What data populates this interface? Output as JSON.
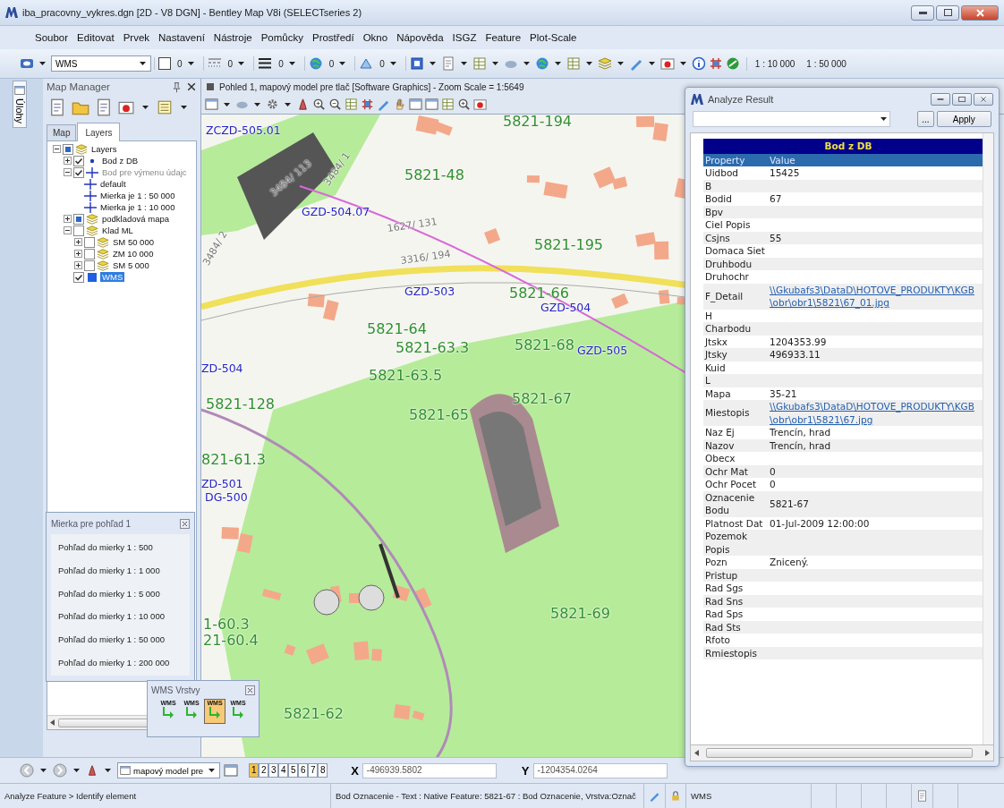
{
  "window": {
    "title": "iba_pracovny_vykres.dgn [2D - V8 DGN] - Bentley Map V8i (SELECTseries 2)"
  },
  "menu": [
    "Soubor",
    "Editovat",
    "Prvek",
    "Nastavení",
    "Nástroje",
    "Pomůcky",
    "Prostředí",
    "Okno",
    "Nápověda",
    "ISGZ",
    "Feature",
    "Plot-Scale"
  ],
  "toolbar": {
    "level": "WMS",
    "attribute_values": [
      "0",
      "0",
      "0",
      "0",
      "0"
    ],
    "scales": [
      "1 : 10 000",
      "1 : 50 000"
    ]
  },
  "side_tab": {
    "label": "Úlohy"
  },
  "map_manager": {
    "title": "Map Manager",
    "tabs": [
      {
        "label": "Map",
        "selected": false
      },
      {
        "label": "Layers",
        "selected": true
      }
    ],
    "tree": [
      {
        "label": "Layers",
        "kind": "group",
        "checked": true,
        "partial": true,
        "expanded": true,
        "selected": false,
        "disabled": false,
        "children": [
          {
            "label": "Bod z DB",
            "kind": "point",
            "checked": true,
            "partial": false,
            "expanded": false,
            "selected": false,
            "disabled": false
          },
          {
            "label": "Bod pre výmenu údajc",
            "kind": "cross",
            "checked": true,
            "partial": false,
            "expanded": true,
            "selected": false,
            "disabled": true,
            "children": [
              {
                "label": "default",
                "kind": "cross",
                "selected": false,
                "disabled": false
              },
              {
                "label": "Mierka je 1 : 50 000",
                "kind": "cross",
                "selected": false,
                "disabled": false
              },
              {
                "label": "Mierka je 1 : 10 000",
                "kind": "cross",
                "selected": false,
                "disabled": false
              }
            ]
          },
          {
            "label": "podkladová mapa",
            "kind": "group",
            "checked": true,
            "partial": true,
            "expanded": false,
            "selected": false,
            "disabled": false
          },
          {
            "label": "Klad ML",
            "kind": "group",
            "checked": false,
            "expanded": true,
            "selected": false,
            "disabled": false,
            "children": [
              {
                "label": "SM 50 000",
                "kind": "group",
                "checked": false,
                "expanded": false,
                "selected": false,
                "disabled": false
              },
              {
                "label": "ZM 10 000",
                "kind": "group",
                "checked": false,
                "expanded": false,
                "selected": false,
                "disabled": false
              },
              {
                "label": "SM 5 000",
                "kind": "group",
                "checked": false,
                "expanded": false,
                "selected": false,
                "disabled": false
              }
            ]
          },
          {
            "label": "WMS",
            "kind": "raster",
            "checked": true,
            "partial": false,
            "selected": true,
            "disabled": false
          }
        ]
      }
    ]
  },
  "map_view": {
    "title": "Pohled 1, mapový model pre tlač [Software Graphics] - Zoom Scale = 1:5649",
    "labels": [
      {
        "text": "5821-194",
        "kind": "point",
        "color": "#2f8f2f"
      },
      {
        "text": "ZCZD-505.01",
        "kind": "station",
        "color": "#2323c8"
      },
      {
        "text": "3484/ 113",
        "kind": "parcel",
        "color": "#777777"
      },
      {
        "text": "3484/ 1",
        "kind": "parcel",
        "color": "#777777"
      },
      {
        "text": "5821-48",
        "kind": "point",
        "color": "#2f8f2f"
      },
      {
        "text": "GZD-504.07",
        "kind": "station",
        "color": "#2323c8"
      },
      {
        "text": "1627/ 131",
        "kind": "parcel",
        "color": "#777777"
      },
      {
        "text": "3484/ 2",
        "kind": "parcel",
        "color": "#777777"
      },
      {
        "text": "3316/ 194",
        "kind": "parcel",
        "color": "#777777"
      },
      {
        "text": "5821-195",
        "kind": "point",
        "color": "#2f8f2f"
      },
      {
        "text": "GZD-503",
        "kind": "station",
        "color": "#2323c8"
      },
      {
        "text": "5821-66",
        "kind": "point",
        "color": "#2f8f2f"
      },
      {
        "text": "GZD-504",
        "kind": "station",
        "color": "#2323c8"
      },
      {
        "text": "5821-64",
        "kind": "point",
        "color": "#2f8f2f"
      },
      {
        "text": "5821-63.3",
        "kind": "point",
        "color": "#2f8f2f"
      },
      {
        "text": "5821-68",
        "kind": "point",
        "color": "#2f8f2f"
      },
      {
        "text": "GZD-505",
        "kind": "station",
        "color": "#2323c8"
      },
      {
        "text": "ZD-504",
        "kind": "station",
        "color": "#2323c8"
      },
      {
        "text": "5821-63.5",
        "kind": "point",
        "color": "#2f8f2f"
      },
      {
        "text": "5821-128",
        "kind": "point",
        "color": "#2f8f2f"
      },
      {
        "text": "5821-67",
        "kind": "point",
        "color": "#2f8f2f"
      },
      {
        "text": "5821-65",
        "kind": "point",
        "color": "#2f8f2f"
      },
      {
        "text": "821-61.3",
        "kind": "point",
        "color": "#2f8f2f"
      },
      {
        "text": "ZD-501",
        "kind": "station",
        "color": "#2323c8"
      },
      {
        "text": "DG-500",
        "kind": "station",
        "color": "#2323c8"
      },
      {
        "text": "1-60.3",
        "kind": "point",
        "color": "#2f8f2f"
      },
      {
        "text": "21-60.4",
        "kind": "point",
        "color": "#2f8f2f"
      },
      {
        "text": "5821-69",
        "kind": "point",
        "color": "#2f8f2f"
      },
      {
        "text": "5821-62",
        "kind": "point",
        "color": "#2f8f2f"
      }
    ]
  },
  "analyze_result": {
    "title": "Analyze Result",
    "buttons": [
      "...",
      "Apply"
    ],
    "table": {
      "title": "Bod z DB",
      "columns": [
        "Property",
        "Value"
      ],
      "rows": [
        {
          "property": "Uidbod",
          "value": "15425",
          "kind": "text"
        },
        {
          "property": "B"
        },
        {
          "property": "Bodid",
          "value": "67",
          "kind": "text"
        },
        {
          "property": "Bpv"
        },
        {
          "property": "Ciel Popis"
        },
        {
          "property": "Csjns",
          "value": "55",
          "kind": "text"
        },
        {
          "property": "Domaca Siet"
        },
        {
          "property": "Druhbodu"
        },
        {
          "property": "Druhochr"
        },
        {
          "property": "F_Detail",
          "value": "\\\\Gkubafs3\\DataD\\HOTOVE_PRODUKTY\\KGB\\obr\\obr1\\5821\\67_01.jpg",
          "kind": "link"
        },
        {
          "property": "H"
        },
        {
          "property": "Charbodu"
        },
        {
          "property": "Jtskx",
          "value": "1204353.99",
          "kind": "text"
        },
        {
          "property": "Jtsky",
          "value": "496933.11",
          "kind": "text"
        },
        {
          "property": "Kuid"
        },
        {
          "property": "L"
        },
        {
          "property": "Mapa",
          "value": "35-21",
          "kind": "text"
        },
        {
          "property": "Miestopis",
          "value": "\\\\Gkubafs3\\DataD\\HOTOVE_PRODUKTY\\KGB\\obr\\obr1\\5821\\67.jpg",
          "kind": "link"
        },
        {
          "property": "Naz Ej",
          "value": "Trencín, hrad",
          "kind": "text"
        },
        {
          "property": "Nazov",
          "value": "Trencín, hrad",
          "kind": "text"
        },
        {
          "property": "Obecx"
        },
        {
          "property": "Ochr Mat",
          "value": "0",
          "kind": "text"
        },
        {
          "property": "Ochr Pocet",
          "value": "0",
          "kind": "text"
        },
        {
          "property": "Oznacenie Bodu",
          "value": "5821-67",
          "kind": "text"
        },
        {
          "property": "Platnost Dat",
          "value": "01-Jul-2009 12:00:00",
          "kind": "text"
        },
        {
          "property": "Pozemok Popis"
        },
        {
          "property": "Pozn",
          "value": "Znicený.",
          "kind": "text"
        },
        {
          "property": "Pristup"
        },
        {
          "property": "Rad Sgs"
        },
        {
          "property": "Rad Sns"
        },
        {
          "property": "Rad Sps"
        },
        {
          "property": "Rad Sts"
        },
        {
          "property": "Rfoto"
        },
        {
          "property": "Rmiestopis"
        }
      ]
    }
  },
  "scale_panel": {
    "title": "Mierka pre pohľad 1",
    "items": [
      "Pohľad do mierky 1 : 500",
      "Pohľad do mierky 1 : 1 000",
      "Pohľad do mierky 1 : 5 000",
      "Pohľad do mierky 1 : 10 000",
      "Pohľad do mierky 1 : 50 000",
      "Pohľad do mierky 1 : 200 000"
    ]
  },
  "wms_panel": {
    "title": "WMS Vrstvy",
    "items": [
      {
        "label": "WMS",
        "selected": false
      },
      {
        "label": "WMS",
        "selected": false
      },
      {
        "label": "WMS",
        "selected": true
      },
      {
        "label": "WMS",
        "selected": false
      }
    ]
  },
  "view_bar": {
    "model": "mapový model pre",
    "views": [
      {
        "label": "1",
        "selected": true
      },
      {
        "label": "2",
        "selected": false
      },
      {
        "label": "3",
        "selected": false
      },
      {
        "label": "4",
        "selected": false
      },
      {
        "label": "5",
        "selected": false
      },
      {
        "label": "6",
        "selected": false
      },
      {
        "label": "7",
        "selected": false
      },
      {
        "label": "8",
        "selected": false
      }
    ],
    "x": {
      "label": "X",
      "value": "-496939.5802"
    },
    "y": {
      "label": "Y",
      "value": "-1204354.0264"
    }
  },
  "status_bar": {
    "prompt": "Analyze Feature > Identify element",
    "message": "Bod Oznacenie - Text : Native Feature: 5821-67 : Bod Oznacenie, Vrstva:Označ",
    "level": "WMS"
  }
}
